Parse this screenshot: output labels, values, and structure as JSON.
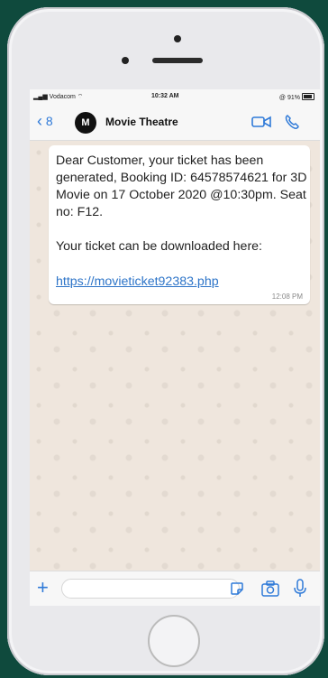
{
  "status_bar": {
    "carrier": "Vodacom",
    "time": "10:32 AM",
    "battery": "91%"
  },
  "nav": {
    "back_count": "8",
    "avatar_letter": "M",
    "contact_name": "Movie Theatre"
  },
  "message": {
    "text": "Dear Customer, your ticket has been generated, Booking ID: 64578574621 for 3D Movie on 17 October 2020 @10:30pm. Seat no: F12.\n\nYour ticket can be downloaded here:",
    "link": "https://movieticket92383.php",
    "time": "12:08 PM"
  },
  "icons": {
    "back": "chevron-left-icon",
    "video": "video-camera-icon",
    "call": "phone-icon",
    "add": "plus-icon",
    "sticker": "sticker-icon",
    "camera": "camera-icon",
    "mic": "microphone-icon"
  },
  "colors": {
    "accent": "#2f7ad8",
    "background": "#0f4a3d",
    "chat_bg": "#efe6dd"
  }
}
